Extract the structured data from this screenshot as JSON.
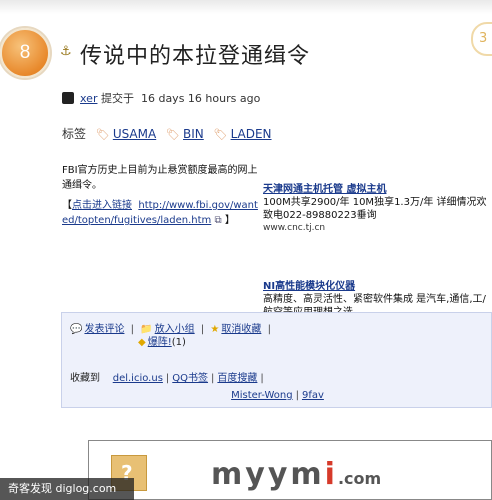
{
  "post": {
    "rank": "8",
    "title": "传说中的本拉登通缉令",
    "comment_count": "3"
  },
  "byline": {
    "user": "xer",
    "action": "提交于",
    "time": "16 days 16 hours ago"
  },
  "tags": {
    "label": "标签",
    "items": [
      "USAMA",
      "BIN",
      "LADEN"
    ]
  },
  "description": {
    "text": "FBI官方历史上目前为止悬赏额度最高的网上通缉令。",
    "link_prefix": "【",
    "link_label": "点击进入链接",
    "link_url": "http://www.fbi.gov/wanted/topten/fugitives/laden.htm",
    "link_suffix": "】"
  },
  "ads": [
    {
      "title": "天津网通主机托管 虚拟主机",
      "body": "100M共享2900/年 10M独享1.3万/年 详细情况欢致电022-89880223垂询",
      "url": "www.cnc.tj.cn"
    },
    {
      "title": "NI高性能模块化仪器",
      "body": "高精度、高灵活性、紧密软件集成 是汽车,通信,工/航空等应用理想之选",
      "url": ""
    }
  ],
  "actions": {
    "comment": "发表评论",
    "add_group": "放入小组",
    "unfavorite": "取消收藏",
    "report": "爆阵!",
    "report_count": "(1)"
  },
  "bookmarks": {
    "label": "收藏到",
    "sites": [
      "del.icio.us",
      "QQ书签",
      "百度搜藏"
    ],
    "sites2": [
      "Mister-Wong",
      "9fav"
    ]
  },
  "banner": {
    "brand_plain": "myym",
    "brand_accent": "i",
    "brand_suffix": ".com"
  },
  "watermark": "奇客发现 diglog.com",
  "colors": {
    "badge": "#e8892c",
    "link": "#1a3a8c",
    "panel_bg": "#eef1fb",
    "brand_accent": "#d63a2a"
  }
}
